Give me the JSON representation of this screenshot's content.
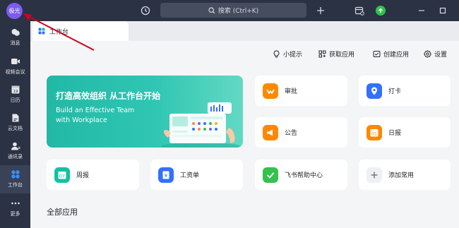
{
  "titlebar": {
    "avatar_text": "极光",
    "search_text": "搜索 (Ctrl+K)",
    "icons": [
      "history-icon",
      "search-icon",
      "plus-icon",
      "calendar-badge-icon",
      "update-icon",
      "minimize-icon",
      "maximize-icon"
    ]
  },
  "sidebar": {
    "items": [
      {
        "label": "消息",
        "icon": "message-icon"
      },
      {
        "label": "视频会议",
        "icon": "video-icon"
      },
      {
        "label": "日历",
        "icon": "calendar-icon"
      },
      {
        "label": "云文档",
        "icon": "document-icon"
      },
      {
        "label": "通讯录",
        "icon": "contacts-icon"
      },
      {
        "label": "工作台",
        "icon": "workplace-icon"
      },
      {
        "label": "更多",
        "icon": "more-icon"
      }
    ]
  },
  "tab": {
    "label": "工作台"
  },
  "toolbar": {
    "tips": "小提示",
    "get_apps": "获取应用",
    "create_app": "创建应用",
    "settings": "设置"
  },
  "banner": {
    "title": "打造高效组织 从工作台开始",
    "sub1": "Build an Effective Team",
    "sub2": "with Workplace"
  },
  "cards": {
    "approval": "审批",
    "checkin": "打卡",
    "announcement": "公告",
    "daily": "日报",
    "weekly": "周报",
    "payslip": "工资单",
    "help": "飞书帮助中心",
    "add": "添加常用"
  },
  "icon_text": {
    "calendar_day": "19",
    "daily": "01",
    "weekly": "07",
    "payslip": "¥"
  },
  "section": {
    "all_apps": "全部应用"
  },
  "colors": {
    "accent": "#3370ff",
    "sidebar_bg": "#2b3244",
    "banner": "#2fc6b3",
    "approval": "#ff8800",
    "checkin": "#3370ff",
    "announcement": "#ff8800",
    "daily": "#ff8800",
    "weekly": "#14c0a4",
    "payslip": "#3370ff",
    "help": "#34c24f",
    "annotation_arrow": "#d0021b"
  }
}
